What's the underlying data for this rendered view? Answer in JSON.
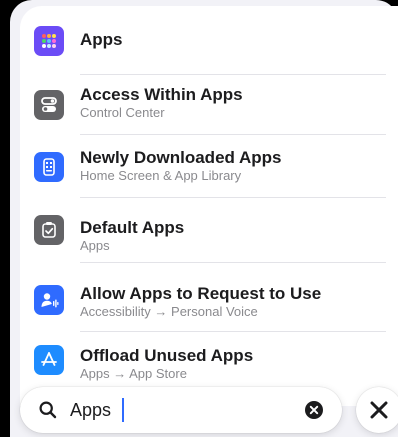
{
  "results": [
    {
      "title": "Apps",
      "subtitle": "",
      "icon": "apps-grid-icon",
      "icon_color": "#6b4cf6"
    },
    {
      "title": "Access Within Apps",
      "subtitle": "Control Center",
      "icon": "control-center-toggles-icon",
      "icon_color": "#636366"
    },
    {
      "title": "Newly Downloaded Apps",
      "subtitle": "Home Screen & App Library",
      "icon": "home-screen-phone-icon",
      "icon_color": "#2f6bff"
    },
    {
      "title": "Default Apps",
      "subtitle": "Apps",
      "icon": "default-apps-checklist-icon",
      "icon_color": "#636366"
    },
    {
      "title": "Allow Apps to Request to Use",
      "subtitle": "Accessibility → Personal Voice",
      "icon": "personal-voice-icon",
      "icon_color": "#2f6bff"
    },
    {
      "title": "Offload Unused Apps",
      "subtitle": "Apps → App Store",
      "icon": "app-store-icon",
      "icon_color": "#1e8cff"
    }
  ],
  "search": {
    "value": "Apps",
    "search_icon": "magnifying-glass-icon",
    "clear_icon": "clear-circle-x-icon"
  },
  "close": {
    "icon": "close-x-icon"
  },
  "colors": {
    "caret": "#2f6bff",
    "sheet_background": "#f2f2f7"
  }
}
